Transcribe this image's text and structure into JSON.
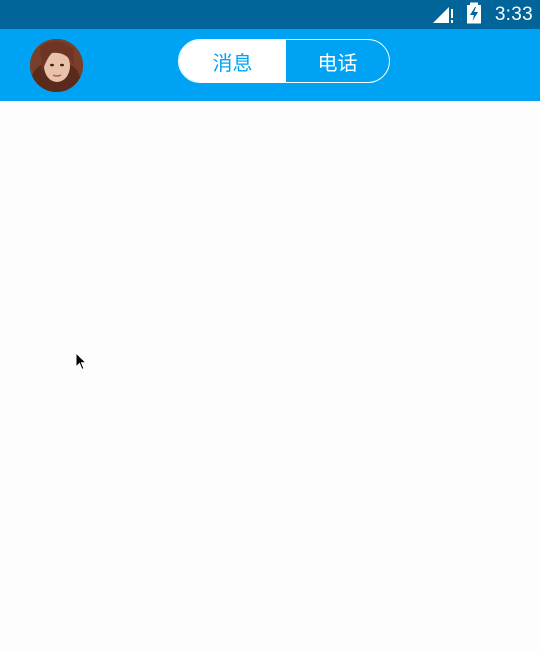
{
  "status_bar": {
    "time": "3:33",
    "signal_icon": "signal-no-data-icon",
    "battery_icon": "battery-charging-icon",
    "background_color": "#02659a"
  },
  "app_bar": {
    "background_color": "#00a3f4",
    "avatar_icon": "user-avatar",
    "tabs": [
      {
        "label": "消息",
        "active": true
      },
      {
        "label": "电话",
        "active": false
      }
    ]
  },
  "content": {
    "background_color": "#fdfdfd"
  },
  "pointer": {
    "icon": "mouse-cursor-icon"
  }
}
